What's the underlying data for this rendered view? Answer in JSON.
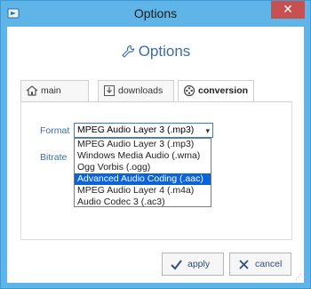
{
  "window": {
    "title": "Options",
    "close_label": "✕"
  },
  "header": {
    "title": "Options"
  },
  "tabs": [
    {
      "label": "main",
      "icon": "house-icon"
    },
    {
      "label": "downloads",
      "icon": "downloads-icon"
    },
    {
      "label": "conversion",
      "icon": "film-reel-icon",
      "active": true
    }
  ],
  "form": {
    "format_label": "Format",
    "bitrate_label": "Bitrate",
    "format_value": "MPEG Audio Layer 3 (.mp3)",
    "format_options": [
      "MPEG Audio Layer 3 (.mp3)",
      "Windows Media Audio (.wma)",
      "Ogg Vorbis (.ogg)",
      "Advanced Audio Coding (.aac)",
      "MPEG Audio Layer 4 (.m4a)",
      "Audio Codec 3 (.ac3)"
    ],
    "highlighted_option": "Advanced Audio Coding (.aac)"
  },
  "buttons": {
    "apply": "apply",
    "cancel": "cancel"
  },
  "colors": {
    "accent": "#3a6ea5",
    "titlebar": "#5fb5e8",
    "close": "#c75050",
    "highlight": "#0a64d8"
  }
}
